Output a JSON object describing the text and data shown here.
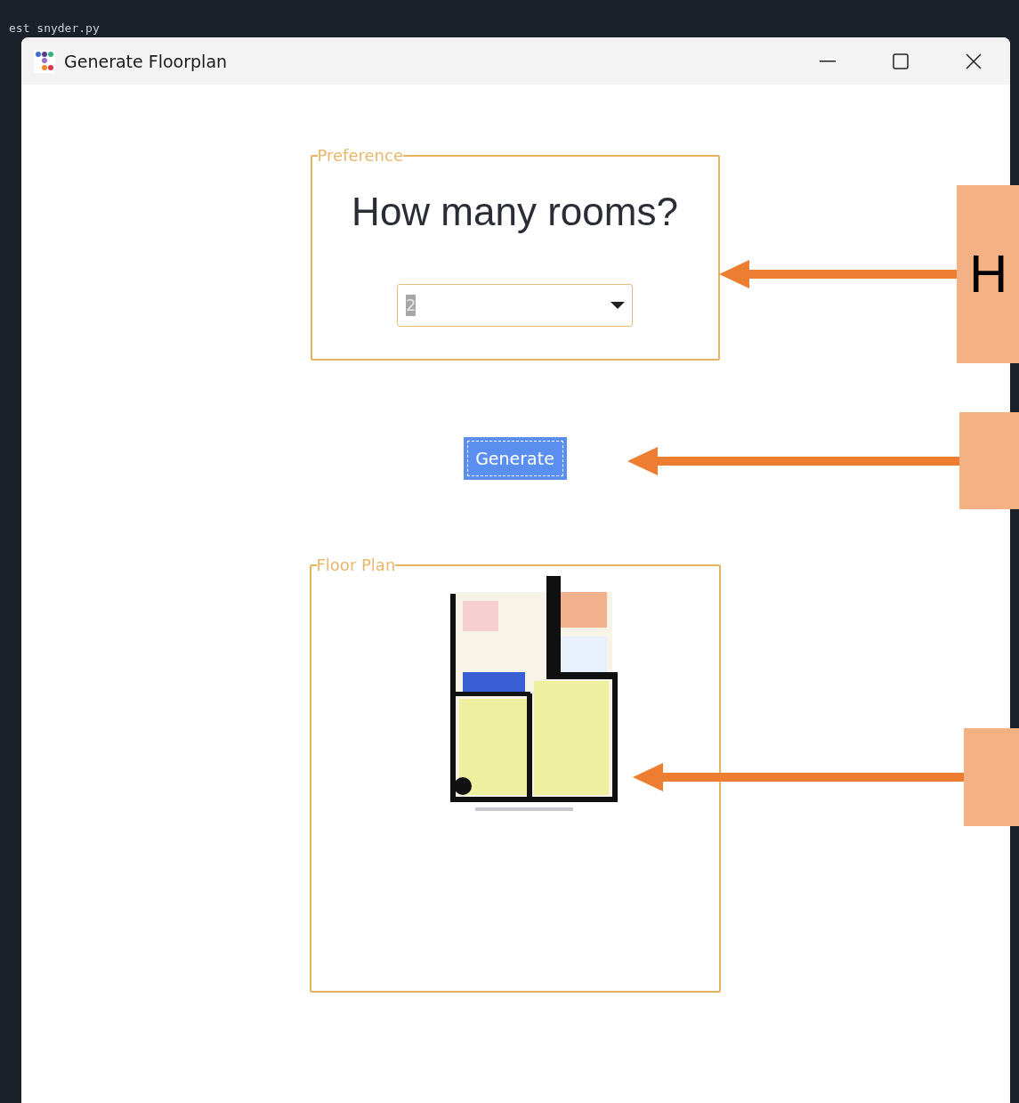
{
  "background": {
    "file_tab": "est snyder.py"
  },
  "window": {
    "title": "Generate Floorplan"
  },
  "preference": {
    "legend": "Preference",
    "question": "How many rooms?",
    "rooms_select": {
      "value": "2"
    }
  },
  "generate_button": {
    "label": "Generate",
    "focused": true
  },
  "floor_plan": {
    "legend": "Floor Plan"
  },
  "callouts": [
    {
      "kind": "arrow_box",
      "text": "H"
    },
    {
      "kind": "arrow_box"
    },
    {
      "kind": "arrow_box"
    }
  ]
}
